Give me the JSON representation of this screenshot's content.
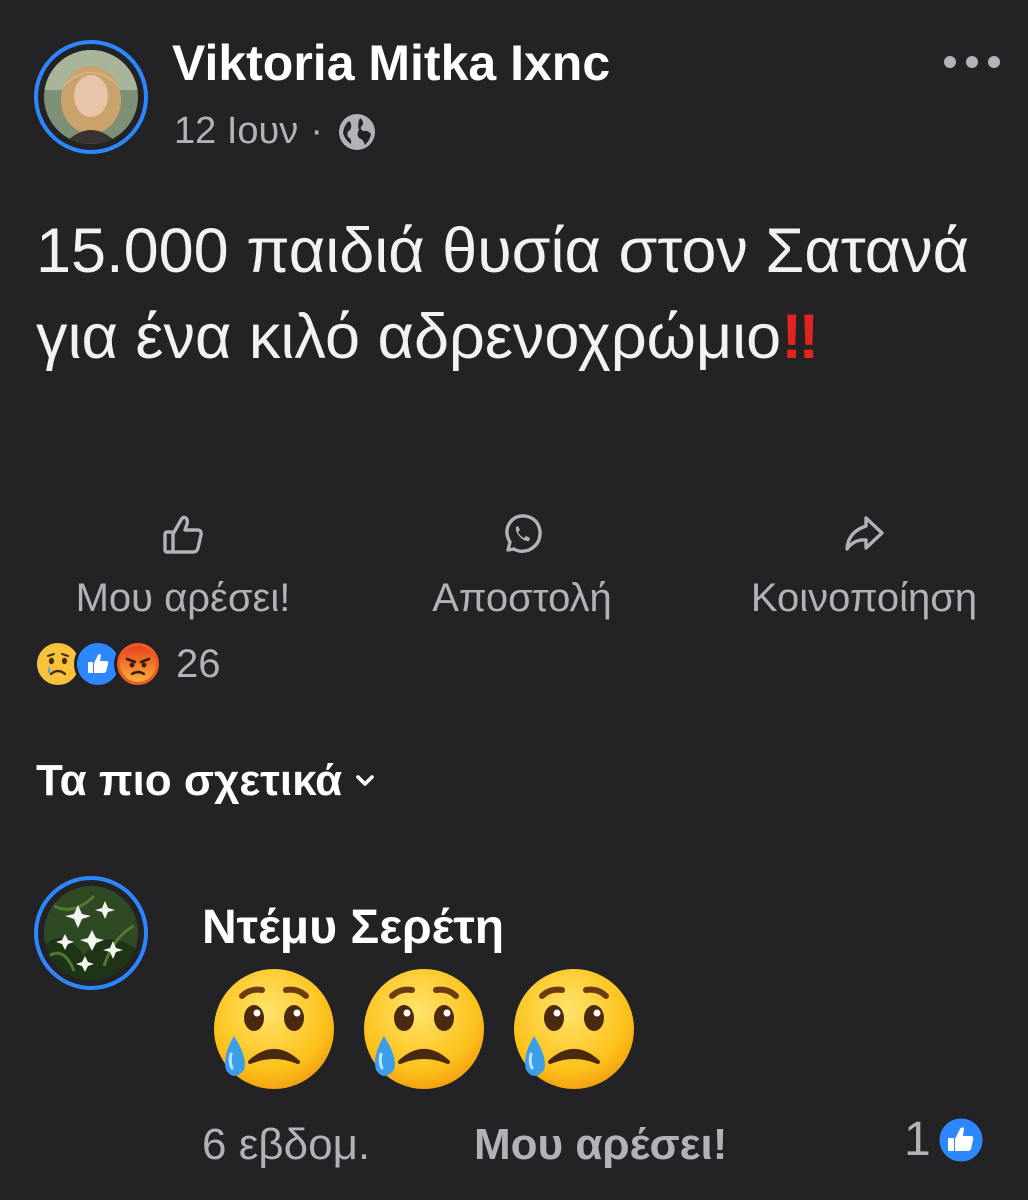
{
  "post": {
    "author": "Viktoria Mitka Ixnc",
    "date": "12 Ιουν",
    "separator": "·",
    "visibility_icon": "globe-icon",
    "text": "15.000 παιδιά θυσία στον Σατανά για ένα κιλό αδρενοχρώμιο",
    "text_emoji": "‼"
  },
  "actions": {
    "like_label": "Μου αρέσει!",
    "send_label": "Αποστολή",
    "share_label": "Κοινοποίηση"
  },
  "reactions": {
    "types": [
      "sad",
      "like",
      "angry"
    ],
    "count": "26"
  },
  "sort": {
    "label": "Τα πιο σχετικά"
  },
  "comment": {
    "author": "Ντέμυ Σερέτη",
    "content_emojis": [
      "sad-tear-emoji",
      "sad-tear-emoji",
      "sad-tear-emoji"
    ],
    "time": "6 εβδομ.",
    "like_label": "Μου αρέσει!",
    "like_count": "1"
  },
  "colors": {
    "background": "#232325",
    "accent_blue": "#2d88ff",
    "secondary_text": "#b0b3b8",
    "alert_red": "#e0241f"
  }
}
